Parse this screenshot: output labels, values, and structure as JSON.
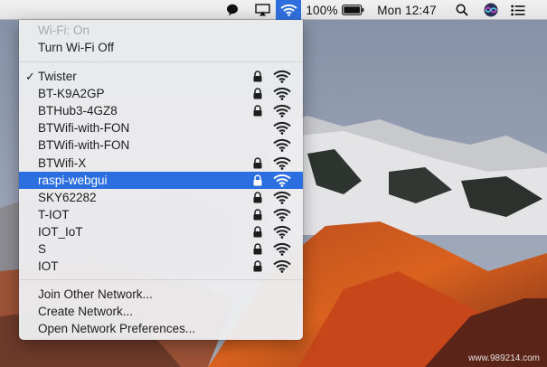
{
  "menubar": {
    "battery_label": "100%",
    "clock": "Mon 12:47",
    "icons": [
      "message-bubble-icon",
      "airplay-icon",
      "wifi-icon",
      "battery-icon",
      "search-icon",
      "siri-icon",
      "notification-center-icon"
    ]
  },
  "wifi_menu": {
    "status": "Wi-Fi: On",
    "toggle": "Turn Wi-Fi Off",
    "networks": [
      {
        "name": "Twister",
        "connected": true,
        "locked": true
      },
      {
        "name": "BT-K9A2GP",
        "connected": false,
        "locked": true
      },
      {
        "name": "BTHub3-4GZ8",
        "connected": false,
        "locked": true
      },
      {
        "name": "BTWifi-with-FON",
        "connected": false,
        "locked": false
      },
      {
        "name": "BTWifi-with-FON",
        "connected": false,
        "locked": false
      },
      {
        "name": "BTWifi-X",
        "connected": false,
        "locked": true
      },
      {
        "name": "raspi-webgui",
        "connected": false,
        "locked": true,
        "highlighted": true
      },
      {
        "name": "SKY62282",
        "connected": false,
        "locked": true
      },
      {
        "name": "T-IOT",
        "connected": false,
        "locked": true
      },
      {
        "name": "IOT_IoT",
        "connected": false,
        "locked": true
      },
      {
        "name": "S",
        "connected": false,
        "locked": true
      },
      {
        "name": "IOT",
        "connected": false,
        "locked": true
      }
    ],
    "actions": [
      "Join Other Network...",
      "Create Network...",
      "Open Network Preferences..."
    ],
    "highlight_color": "#2a6ee0"
  },
  "watermark": "www.989214.com"
}
